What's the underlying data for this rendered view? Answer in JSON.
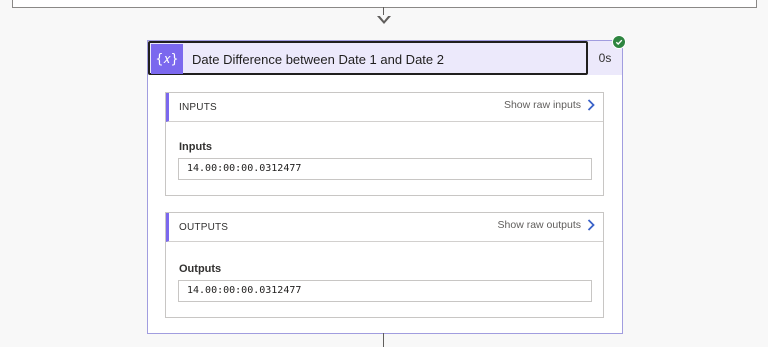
{
  "action": {
    "title": "Date Difference between Date 1 and Date 2",
    "icon_glyph": "{𝑥}",
    "icon": "expression-icon",
    "duration": "0s",
    "status_icon": "success-check-icon"
  },
  "inputs": {
    "section_title": "INPUTS",
    "raw_link": "Show raw inputs",
    "field_label": "Inputs",
    "field_value": "14.00:00:00.0312477"
  },
  "outputs": {
    "section_title": "OUTPUTS",
    "raw_link": "Show raw outputs",
    "field_label": "Outputs",
    "field_value": "14.00:00:00.0312477"
  },
  "colors": {
    "accent": "#7b68ee",
    "header_bg": "#ece9fb",
    "success": "#2e8540",
    "link_chevron": "#3a62c9"
  }
}
